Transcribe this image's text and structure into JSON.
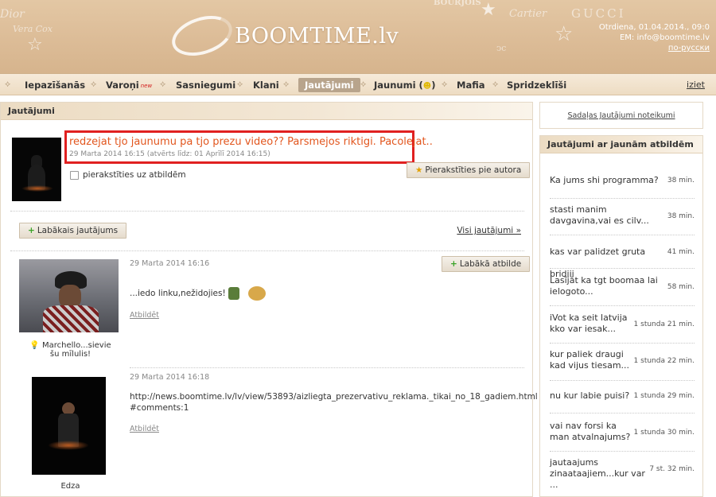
{
  "header": {
    "logo_text": "BOOMTIME.lv",
    "date_line": "Otrdiena, 01.04.2014., 09:0",
    "email_line": "EM: info@boomtime.lv",
    "lang_link": "по-русски",
    "deco_brands": [
      "Dior",
      "BOURJOIS",
      "Cartier",
      "GUCCI",
      "Vera Cox"
    ]
  },
  "nav": {
    "items": [
      {
        "label": "Iepazīšanās"
      },
      {
        "label": "Varoņi",
        "badge": "new"
      },
      {
        "label": "Sasniegumi"
      },
      {
        "label": "Klani"
      },
      {
        "label": "Jautājumi",
        "active": true
      },
      {
        "label": "Jaunumi (",
        "suffix": ")"
      },
      {
        "label": "Mafia"
      },
      {
        "label": "Spridzeklīši"
      }
    ],
    "logout": "iziet"
  },
  "main": {
    "title": "Jautājumi",
    "question": {
      "title": "redzejat tjo jaunumu pa tjo prezu video?? Parsmejos riktigi. Pacolejat..",
      "meta": "29 Marta 2014 16:15 (atvērts līdz: 01 Aprīlī 2014 16:15)",
      "subscribe_label": "pierakstīties uz atbildēm",
      "subscribe_author_btn": "Pierakstīties pie autora"
    },
    "best_question_btn": "Labākais jautājums",
    "all_questions_link": "Visi jautājumi »",
    "answers": [
      {
        "date": "29 Marta 2014 16:16",
        "text": "...iedo linku,nežidojies!",
        "reply_label": "Atbildēt",
        "user": "Marchello...sievie šu mīlulis!",
        "best_btn": "Labākā atbilde"
      },
      {
        "date": "29 Marta 2014 16:18",
        "text": "http://news.boomtime.lv/lv/view/53893/aizliegta_prezervativu_reklama._tikai_no_18_gadiem.html #comments:1",
        "reply_label": "Atbildēt",
        "user": "Edza"
      }
    ]
  },
  "sidebar": {
    "rules_link": "Sadaļas Jautājumi noteikumi",
    "new_title": "Jautājumi ar jaunām atbildēm",
    "items": [
      {
        "text": "Ka jums shi programma?",
        "time": "38 min."
      },
      {
        "text": "stasti manim davgavina,vai es cilv...",
        "time": "38 min."
      },
      {
        "text": "kas var palidzet gruta bridiii",
        "time": "41 min."
      },
      {
        "text": "Lasījāt ka tgt boomaa lai ielogoto...",
        "time": "58 min."
      },
      {
        "text": "iVot ka seit latvija kko var iesak...",
        "time": "1 stunda 21 min."
      },
      {
        "text": "kur paliek draugi kad vijus tiesam...",
        "time": "1 stunda 22 min."
      },
      {
        "text": "nu kur labie puisi?",
        "time": "1 stunda 29 min."
      },
      {
        "text": "vai nav forsi ka man atvalnajums?",
        "time": "1 stunda 30 min."
      },
      {
        "text": "jautaajums zinaataajiem...kur var ...",
        "time": "7 st. 32 min."
      }
    ]
  }
}
